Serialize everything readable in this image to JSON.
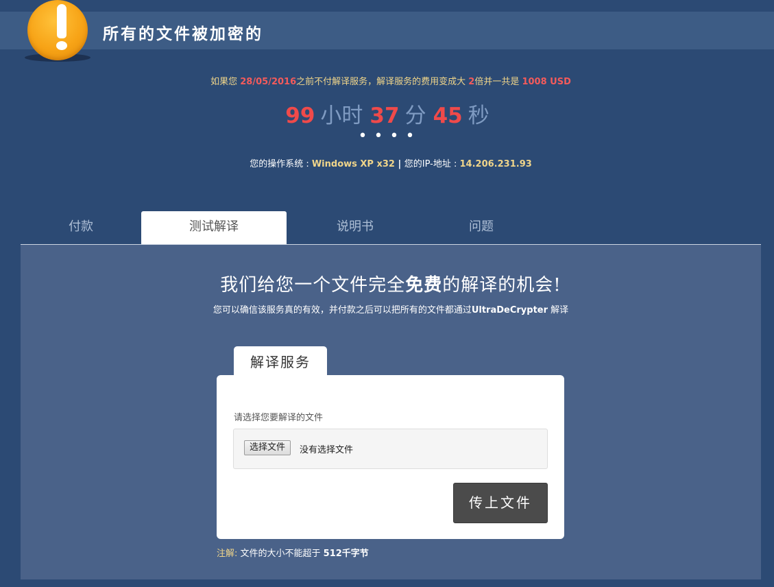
{
  "header": {
    "title": "所有的文件被加密的",
    "icon": "exclamation-icon",
    "icon_color": "#f7a316"
  },
  "deadline": {
    "prefix": "如果您 ",
    "date": "28/05/2016",
    "middle": "之前不付解译服务，解译服务的费用变成大 ",
    "multiplier": "2",
    "after_multiplier": "倍并一共是 ",
    "amount": "1008 USD"
  },
  "timer": {
    "hours": "99",
    "hours_unit": "小时",
    "minutes": "37",
    "minutes_unit": "分",
    "seconds": "45",
    "seconds_unit": "秒"
  },
  "dots": "••••",
  "system": {
    "os_label": "您的操作系统 : ",
    "os_value": "Windows XP x32",
    "separator": " | ",
    "ip_label": "您的IP-地址 : ",
    "ip_value": "14.206.231.93"
  },
  "tabs": [
    {
      "label": "付款",
      "active": false
    },
    {
      "label": "测试解译",
      "active": true
    },
    {
      "label": "说明书",
      "active": false
    },
    {
      "label": "问题",
      "active": false
    }
  ],
  "panel": {
    "heading_before": "我们给您一个文件完全",
    "heading_bold": "免费",
    "heading_after": "的解译的机会!",
    "sub_before": "您可以确信该服务真的有效，并付款之后可以把所有的文件都通过",
    "sub_bold": "UltraDeCrypter",
    "sub_after": " 解译"
  },
  "card": {
    "tab_label": "解译服务",
    "field_label": "请选择您要解译的文件",
    "file_button": "选择文件",
    "file_status": "没有选择文件",
    "upload_button": "传上文件"
  },
  "note": {
    "label": "注解:",
    "text": " 文件的大小不能超于 ",
    "size": "512千字节"
  },
  "colors": {
    "background": "#2c4a74",
    "header_bar": "#3d5c85",
    "panel": "#4a6289",
    "accent_red": "#f04a4a",
    "accent_yellow": "#f0d58a"
  }
}
